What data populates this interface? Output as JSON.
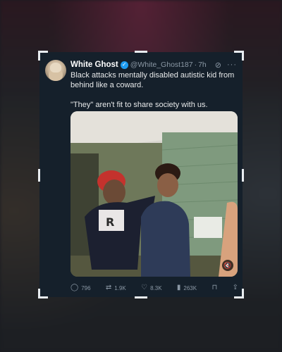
{
  "tweet": {
    "author_name": "White Ghost",
    "handle": "@White_Ghost187",
    "separator": "·",
    "time": "7h",
    "text_line1": "Black attacks mentally disabled autistic kid from behind like a coward.",
    "text_line2": "\"They\" aren't fit to share society with us."
  },
  "actions": {
    "replies": "796",
    "retweets": "1.9K",
    "likes": "8.3K",
    "views": "263K"
  },
  "icons": {
    "verified": "verified-badge-icon",
    "grok": "grok-icon",
    "more": "more-icon",
    "volume": "volume-muted-icon",
    "reply": "reply-icon",
    "retweet": "retweet-icon",
    "like": "heart-icon",
    "views": "views-icon",
    "bookmark": "bookmark-icon",
    "share": "share-icon"
  },
  "colors": {
    "card_bg": "#15202b",
    "verified": "#1d9bf0",
    "muted_text": "#8b98a5",
    "primary_text": "#e7e9ea"
  }
}
